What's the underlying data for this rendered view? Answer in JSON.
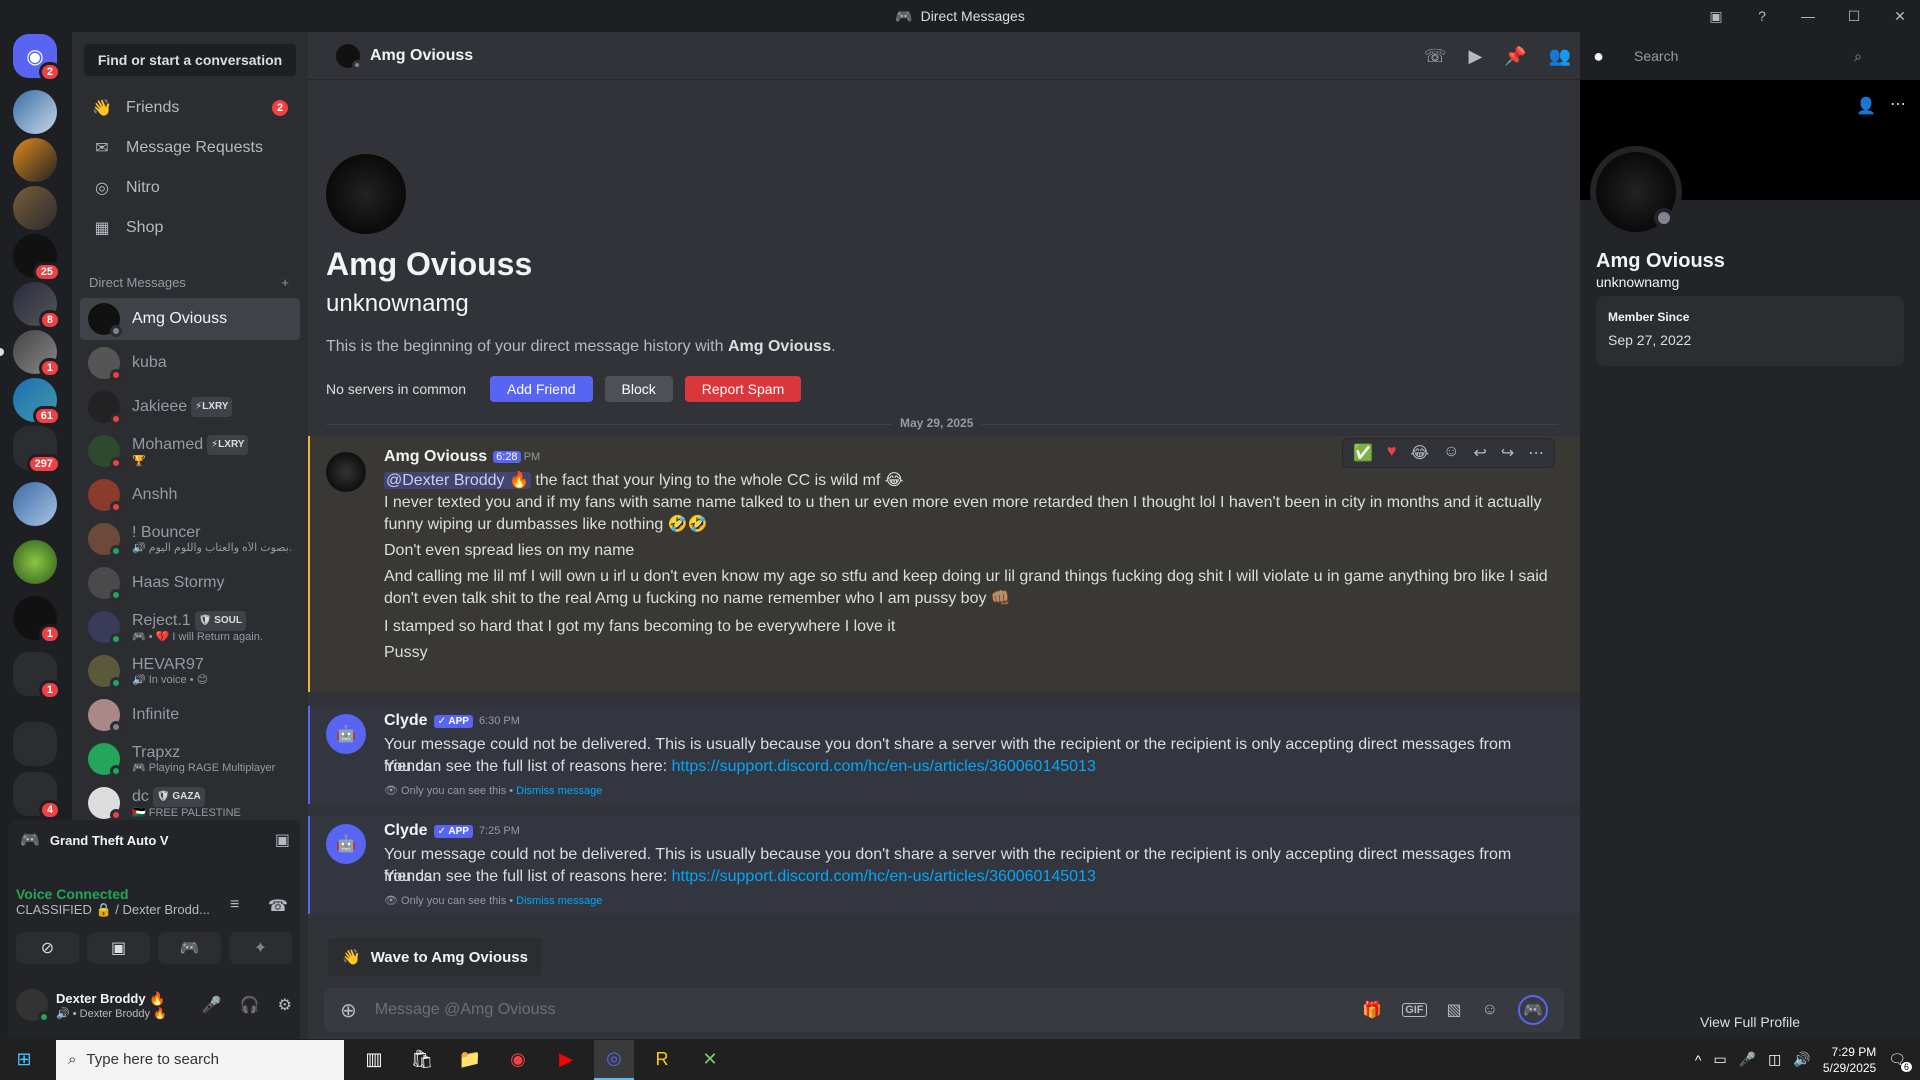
{
  "window": {
    "title": "Direct Messages"
  },
  "servers": [
    {
      "badge": "2"
    },
    {
      "badge": ""
    },
    {
      "badge": ""
    },
    {
      "badge": ""
    },
    {
      "badge": "25"
    },
    {
      "badge": "8"
    },
    {
      "badge": "1"
    },
    {
      "badge": "61"
    },
    {
      "badge": "297"
    },
    {
      "badge": ""
    },
    {
      "badge": ""
    },
    {
      "badge": "1"
    },
    {
      "badge": "1"
    },
    {
      "badge": ""
    },
    {
      "badge": "4"
    }
  ],
  "sidebar": {
    "search_label": "Find or start a conversation",
    "nav": [
      {
        "label": "Friends",
        "badge": "2"
      },
      {
        "label": "Message Requests"
      },
      {
        "label": "Nitro"
      },
      {
        "label": "Shop"
      }
    ],
    "dm_header": "Direct Messages",
    "dm_add": "+",
    "dms": [
      {
        "name": "Amg Oviouss",
        "sub": "",
        "tag": ""
      },
      {
        "name": "kuba",
        "sub": "",
        "tag": ""
      },
      {
        "name": "Jakieee",
        "sub": "",
        "tag": "⚡LXRY"
      },
      {
        "name": "Mohamed",
        "sub": "🏆",
        "tag": "⚡LXRY"
      },
      {
        "name": "Anshh",
        "sub": "",
        "tag": ""
      },
      {
        "name": "! Bouncer",
        "sub": "🔊 ﺑﺼﻮﺕ ﺍﻵﻩ ﻭﺍﻟﻌﺘﺎﺏ ﻭﺍﻟﻠﻮﻡ ﺍﻟﻴﻮﻡ...",
        "tag": ""
      },
      {
        "name": "Haas Stormy",
        "sub": "",
        "tag": ""
      },
      {
        "name": "Reject.1",
        "sub": "🎮 • 💔 I will Return again.",
        "tag": "🛡 SOUL"
      },
      {
        "name": "HEVAR97",
        "sub": "🔊 In voice • 😊",
        "tag": ""
      },
      {
        "name": "Infinite",
        "sub": "",
        "tag": ""
      },
      {
        "name": "Trapxz",
        "sub": "🎮 Playing RAGE Multiplayer",
        "tag": ""
      },
      {
        "name": "dc",
        "sub": "🇵🇸 FREE PALESTINE",
        "tag": "🛡 GAZA"
      }
    ]
  },
  "panel": {
    "game": "Grand Theft Auto V",
    "voice_status": "Voice Connected",
    "voice_channel": "CLASSIFIED 🔒 / Dexter Brodd...",
    "user_name": "Dexter Broddy 🔥",
    "user_sub": "🔊 • Dexter Broddy 🔥"
  },
  "header": {
    "name": "Amg Oviouss",
    "search_placeholder": "Search"
  },
  "intro": {
    "display_name": "Amg Oviouss",
    "username": "unknownamg",
    "beginning_prefix": "This is the beginning of your direct message history with ",
    "beginning_name": "Amg Oviouss",
    "beginning_suffix": ".",
    "no_servers": "No servers in common",
    "add_friend": "Add Friend",
    "block": "Block",
    "report": "Report Spam"
  },
  "divider_date": "May 29, 2025",
  "messages": [
    {
      "author": "Amg Oviouss",
      "time": "6:28",
      "time_suffix": "PM",
      "mention": "@Dexter Broddy 🔥",
      "lines": [
        " the fact that your lying to the whole CC is wild mf 😂",
        "I never texted you and if my fans with same name talked to u then ur even more even more retarded then I thought lol I haven't been in city in months and it actually funny wiping ur dumbasses like nothing 🤣🤣",
        "Don't even spread lies on my name",
        "And calling me lil mf I will own u irl u don't even know my age so stfu and keep doing ur lil grand things fucking dog shit I will violate u in game anything bro like I said don't even talk shit to the real Amg u fucking no name remember who I am pussy boy 👊🏽",
        "I stamped so hard that I got my fans becoming to be everywhere I love it",
        "Pussy"
      ]
    },
    {
      "author": "Clyde",
      "app": "✓ APP",
      "time": "6:30 PM",
      "line1": "Your message could not be delivered. This is usually because you don't share a server with the recipient or the recipient is only accepting direct messages from friends.",
      "line2_prefix": "You can see the full list of reasons here: ",
      "link": "https://support.discord.com/hc/en-us/articles/360060145013",
      "eph": "Only you can see this • ",
      "dismiss": "Dismiss message"
    },
    {
      "author": "Clyde",
      "app": "✓ APP",
      "time": "7:25 PM",
      "line1": "Your message could not be delivered. This is usually because you don't share a server with the recipient or the recipient is only accepting direct messages from friends.",
      "line2_prefix": "You can see the full list of reasons here: ",
      "link": "https://support.discord.com/hc/en-us/articles/360060145013",
      "eph": "Only you can see this • ",
      "dismiss": "Dismiss message"
    }
  ],
  "wave": "Wave to Amg Oviouss",
  "composer": {
    "placeholder": "Message @Amg Oviouss"
  },
  "profile": {
    "display_name": "Amg Oviouss",
    "username": "unknownamg",
    "member_since_label": "Member Since",
    "member_since": "Sep 27, 2022",
    "view_full": "View Full Profile"
  },
  "taskbar": {
    "search": "Type here to search",
    "time": "7:29 PM",
    "date": "5/29/2025",
    "notif": "6"
  },
  "colors": {
    "blurple": "#5865f2",
    "danger": "#da373c",
    "online": "#23a55a",
    "dnd": "#f23f43",
    "idle": "#f0b232"
  }
}
